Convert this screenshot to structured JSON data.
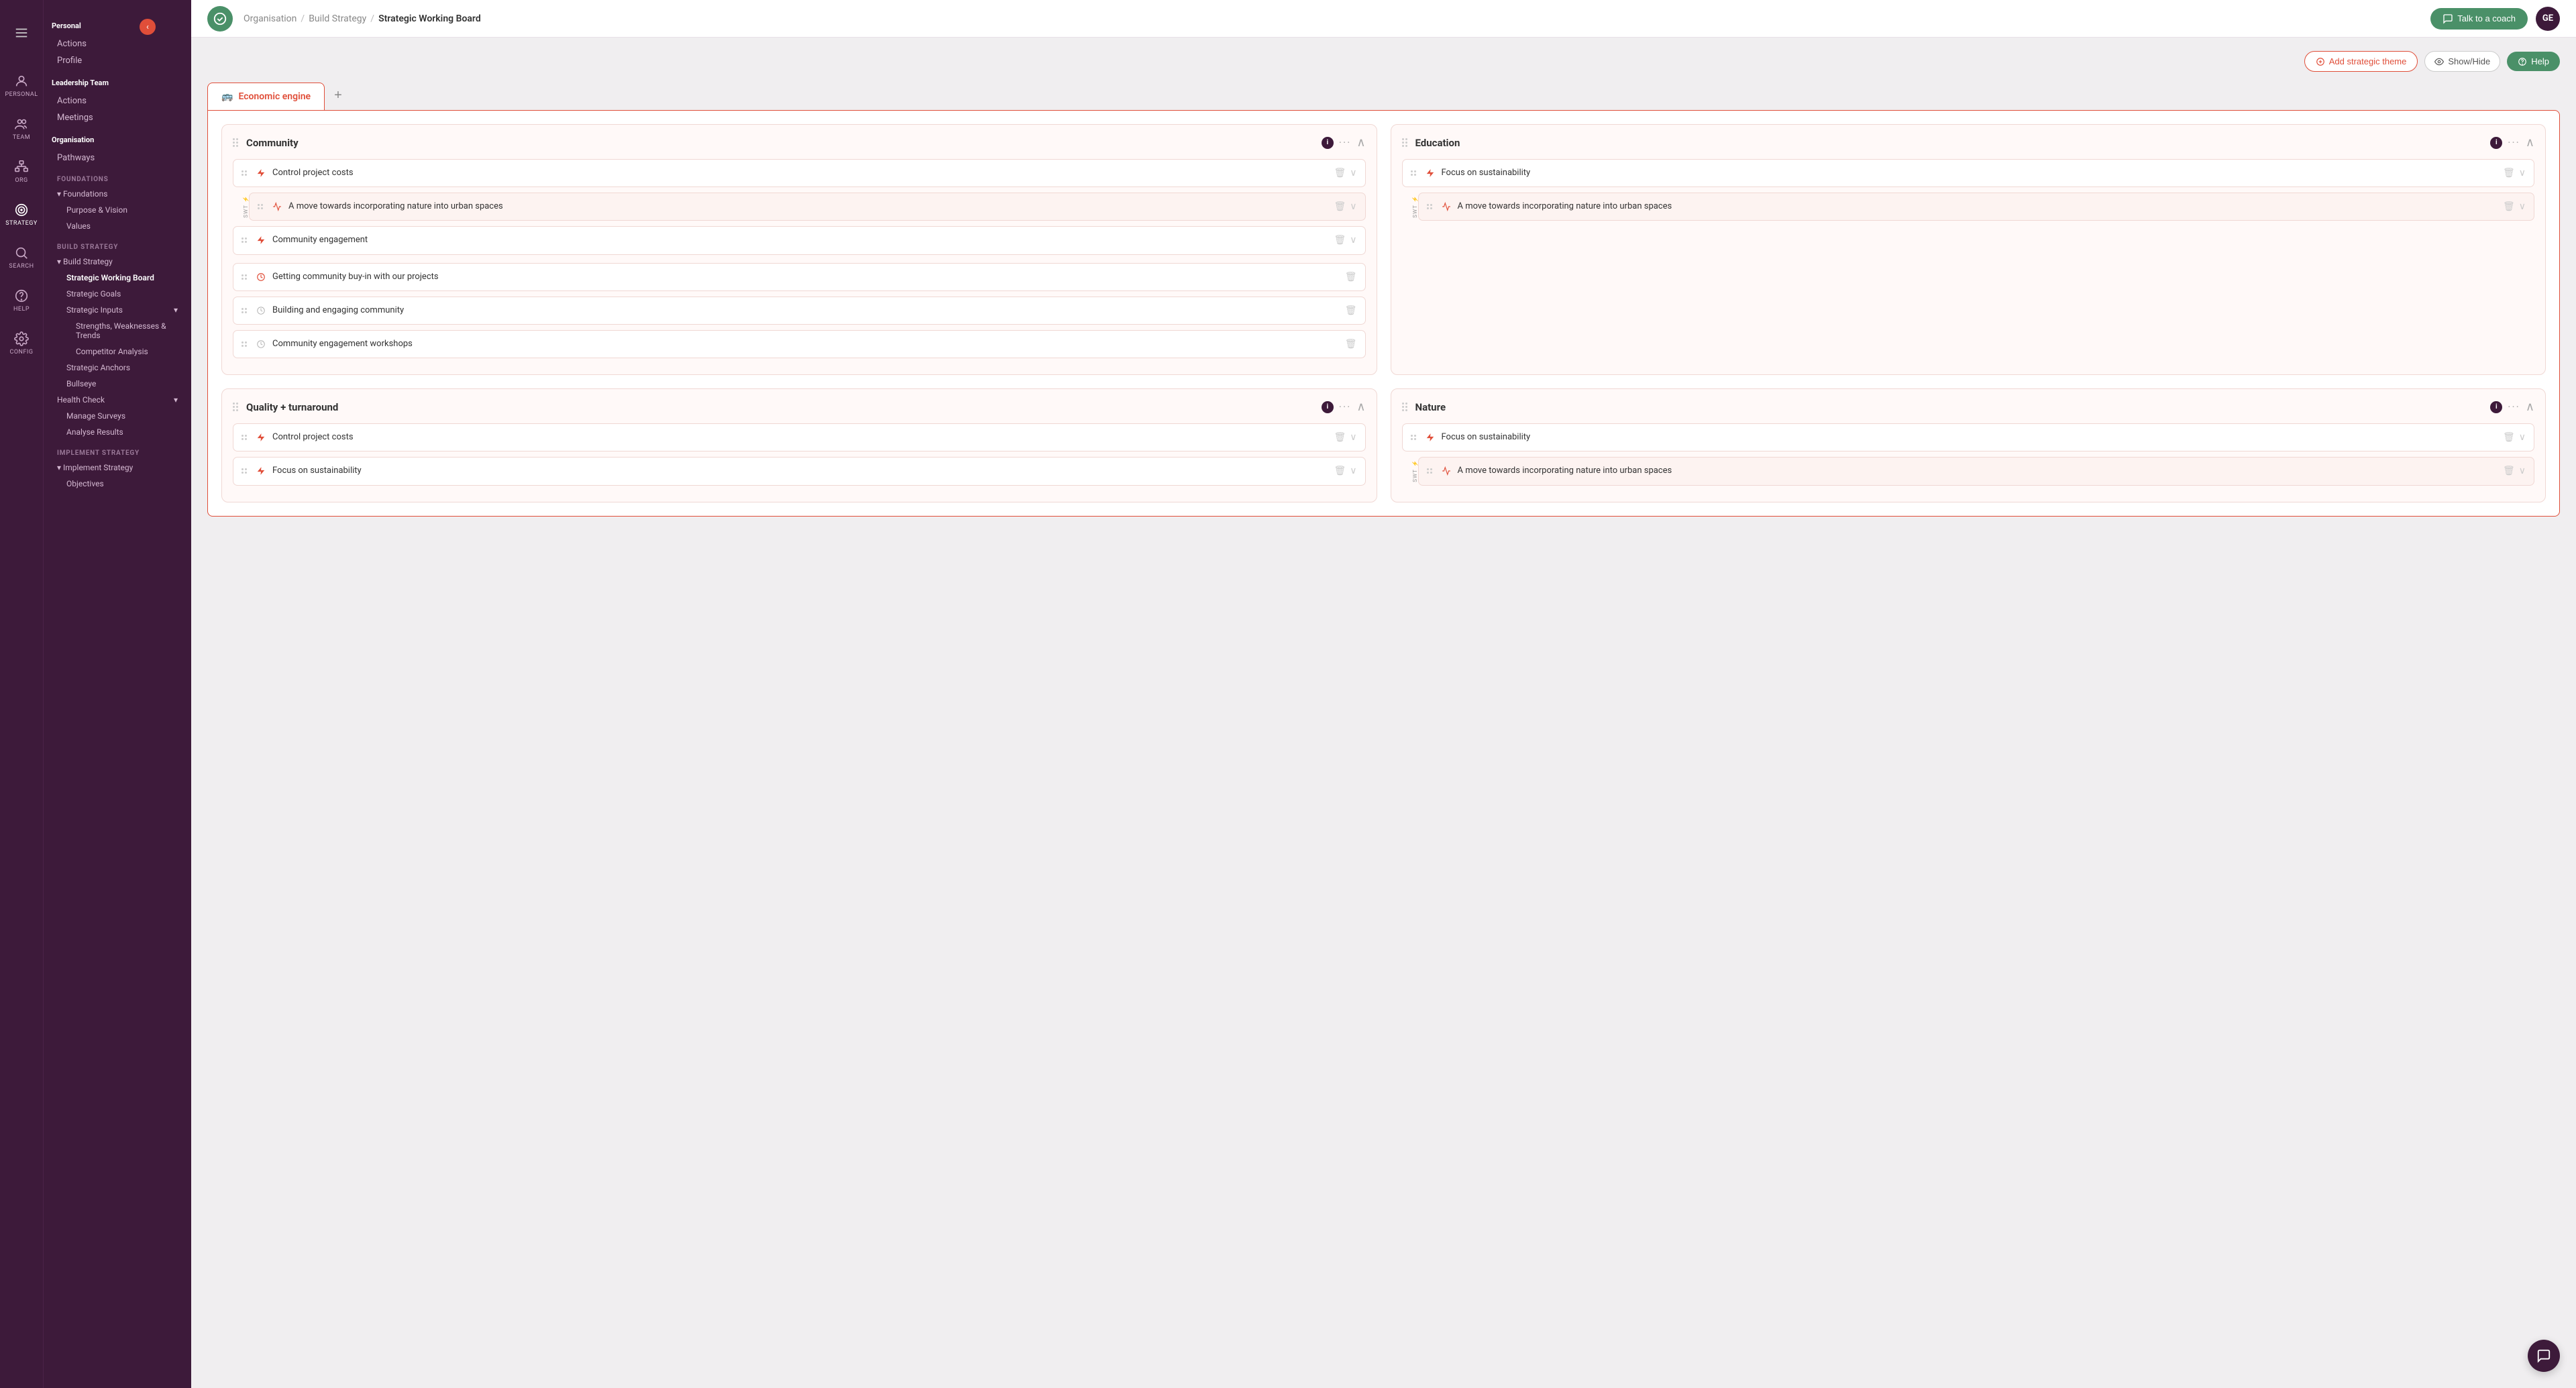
{
  "app": {
    "title": "Strategic Working Board"
  },
  "topnav": {
    "breadcrumb": {
      "org": "Organisation",
      "strategy": "Build Strategy",
      "current": "Strategic Working Board"
    },
    "coach_btn": "Talk to a coach",
    "avatar": "GE"
  },
  "toolbar": {
    "add_theme": "Add strategic theme",
    "show_hide": "Show/Hide",
    "help": "Help"
  },
  "sidebar_icons": [
    {
      "name": "personal-icon",
      "label": "PERSONAL",
      "active": false
    },
    {
      "name": "team-icon",
      "label": "TEAM",
      "active": false
    },
    {
      "name": "org-icon",
      "label": "ORG",
      "active": false
    },
    {
      "name": "strategy-icon",
      "label": "STRATEGY",
      "active": true
    },
    {
      "name": "search-icon",
      "label": "SEARCH",
      "active": false
    },
    {
      "name": "help-icon",
      "label": "HELP",
      "active": false
    },
    {
      "name": "config-icon",
      "label": "CONFIG",
      "active": false
    }
  ],
  "sidebar": {
    "personal_section": "Personal",
    "personal_items": [
      {
        "label": "Actions"
      },
      {
        "label": "Profile"
      }
    ],
    "leadership_section": "Leadership Team",
    "leadership_items": [
      {
        "label": "Actions"
      },
      {
        "label": "Meetings"
      }
    ],
    "org_section": "Organisation",
    "org_items": [
      {
        "label": "Pathways"
      }
    ],
    "foundations_label": "FOUNDATIONS",
    "foundations_items": [
      {
        "label": "Purpose & Vision"
      },
      {
        "label": "Values"
      }
    ],
    "build_strategy_label": "BUILD STRATEGY",
    "build_strategy_items": [
      {
        "label": "Strategic Working Board",
        "active": true
      },
      {
        "label": "Strategic Goals"
      }
    ],
    "strategic_inputs_label": "Strategic Inputs",
    "strategic_inputs_sub": [
      {
        "label": "Strengths, Weaknesses & Trends"
      },
      {
        "label": "Competitor Analysis"
      }
    ],
    "more_build": [
      {
        "label": "Strategic Anchors"
      },
      {
        "label": "Bullseye"
      }
    ],
    "health_check_label": "Health Check",
    "health_check_items": [
      {
        "label": "Manage Surveys"
      },
      {
        "label": "Analyse Results"
      }
    ],
    "implement_label": "IMPLEMENT STRATEGY",
    "implement_items": [
      {
        "label": "Objectives"
      }
    ]
  },
  "tab": {
    "icon": "🚌",
    "label": "Economic engine"
  },
  "columns": [
    {
      "id": "community",
      "title": "Community",
      "items_top": [
        {
          "id": "c1",
          "icon": "bolt",
          "text": "Control project costs",
          "type": "flash"
        },
        {
          "id": "c2",
          "icon": "chart",
          "text": "A move towards incorporating nature into urban spaces",
          "type": "chart",
          "swt": true
        },
        {
          "id": "c3",
          "icon": "bolt",
          "text": "Community engagement",
          "type": "flash"
        }
      ],
      "items_bottom": [
        {
          "id": "c4",
          "icon": "clock",
          "text": "Getting community buy-in with our projects",
          "type": "clock"
        },
        {
          "id": "c5",
          "icon": "clock-outline",
          "text": "Building and engaging community",
          "type": "clock-outline"
        },
        {
          "id": "c6",
          "icon": "clock-outline",
          "text": "Community engagement workshops",
          "type": "clock-outline"
        }
      ]
    },
    {
      "id": "education",
      "title": "Education",
      "items_top": [
        {
          "id": "e1",
          "icon": "bolt",
          "text": "Focus on sustainability",
          "type": "flash"
        },
        {
          "id": "e2",
          "icon": "chart",
          "text": "A move towards incorporating nature into urban spaces",
          "type": "chart",
          "swt": true
        }
      ]
    },
    {
      "id": "quality",
      "title": "Quality + turnaround",
      "items_top": [
        {
          "id": "q1",
          "icon": "bolt",
          "text": "Control project costs",
          "type": "flash"
        },
        {
          "id": "q2",
          "icon": "bolt",
          "text": "Focus on sustainability",
          "type": "flash"
        }
      ]
    },
    {
      "id": "nature",
      "title": "Nature",
      "items_top": [
        {
          "id": "n1",
          "icon": "bolt",
          "text": "Focus on sustainability",
          "type": "flash"
        },
        {
          "id": "n2",
          "icon": "chart",
          "text": "A move towards incorporating nature into urban spaces",
          "type": "chart",
          "swt": true
        }
      ]
    }
  ]
}
